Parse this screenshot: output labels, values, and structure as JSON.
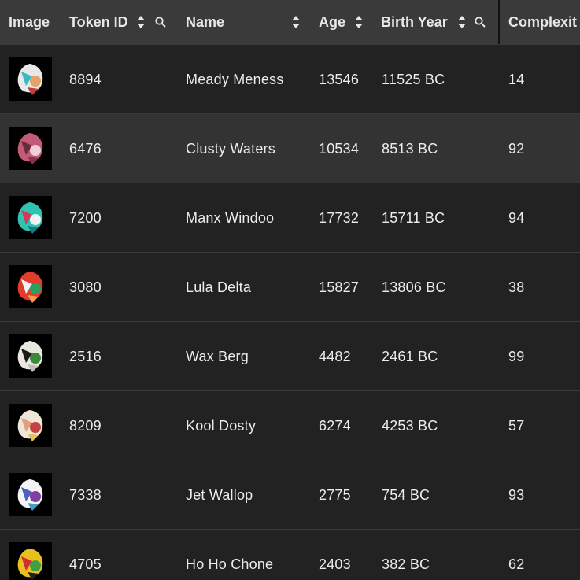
{
  "header": {
    "image": "Image",
    "token_id": "Token ID",
    "name": "Name",
    "age": "Age",
    "birth_year": "Birth Year",
    "complexity": "Complexit"
  },
  "rows": [
    {
      "token_id": "8894",
      "name": "Meady Meness",
      "age": "13546",
      "birth_year": "11525 BC",
      "complexity": "14",
      "thumb": [
        "#e8e8e8",
        "#3bb8c4",
        "#e3a36b",
        "#c43b3b"
      ]
    },
    {
      "token_id": "6476",
      "name": "Clusty Waters",
      "age": "10534",
      "birth_year": "8513 BC",
      "complexity": "92",
      "thumb": [
        "#c25a78",
        "#6a2a3a",
        "#f0d0d8",
        "#8a3050"
      ]
    },
    {
      "token_id": "7200",
      "name": "Manx Windoo",
      "age": "17732",
      "birth_year": "15711 BC",
      "complexity": "94",
      "thumb": [
        "#2ec4b0",
        "#d13a5a",
        "#f2f2f2",
        "#1a7a8a"
      ]
    },
    {
      "token_id": "3080",
      "name": "Lula Delta",
      "age": "15827",
      "birth_year": "13806 BC",
      "complexity": "38",
      "thumb": [
        "#e23c2c",
        "#f4f4f4",
        "#2aa060",
        "#f0a050"
      ]
    },
    {
      "token_id": "2516",
      "name": "Wax Berg",
      "age": "4482",
      "birth_year": "2461 BC",
      "complexity": "99",
      "thumb": [
        "#e8e8e0",
        "#1a1a1a",
        "#3a8a3a",
        "#c0c0b0"
      ]
    },
    {
      "token_id": "8209",
      "name": "Kool Dosty",
      "age": "6274",
      "birth_year": "4253 BC",
      "complexity": "57",
      "thumb": [
        "#f0e6d8",
        "#e0a080",
        "#c84040",
        "#e8c060"
      ]
    },
    {
      "token_id": "7338",
      "name": "Jet Wallop",
      "age": "2775",
      "birth_year": "754 BC",
      "complexity": "93",
      "thumb": [
        "#f4f4f4",
        "#5060c0",
        "#8040a0",
        "#40a0c0"
      ]
    },
    {
      "token_id": "4705",
      "name": "Ho Ho Chone",
      "age": "2403",
      "birth_year": "382 BC",
      "complexity": "62",
      "thumb": [
        "#e8c020",
        "#d03030",
        "#40a040",
        "#202020"
      ]
    }
  ],
  "highlighted_row_index": 1,
  "colors": {
    "background": "#222222",
    "header_background": "#3a3a3a",
    "highlight_row": "#333333",
    "text": "#ececec"
  },
  "icons": {
    "sort": "sort-icon",
    "search": "search-icon"
  }
}
